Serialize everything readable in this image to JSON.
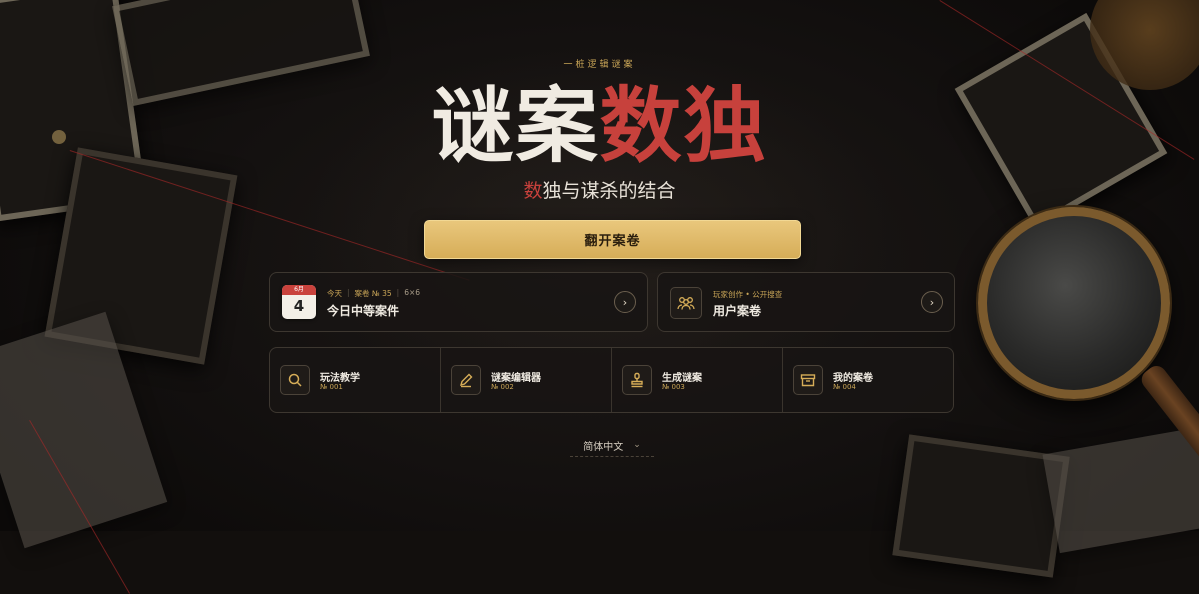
{
  "hero": {
    "tagline": "一桩逻辑谜案",
    "title_part1": "谜案",
    "title_part2": "数独",
    "subtitle_first": "数",
    "subtitle_rest": "独与谋杀的结合"
  },
  "cta": {
    "label": "翻开案卷"
  },
  "daily_case": {
    "calendar_month": "6月",
    "calendar_day": "4",
    "meta_today": "今天",
    "meta_case": "案卷 № 35",
    "meta_size": "6×6",
    "title": "今日中等案件",
    "arrow": "›"
  },
  "user_cases": {
    "meta": "玩家创作 • 公开搜查",
    "title": "用户案卷",
    "arrow": "›"
  },
  "tools": [
    {
      "label": "玩法教学",
      "number": "№ 001",
      "icon": "magnifier-icon"
    },
    {
      "label": "谜案编辑器",
      "number": "№ 002",
      "icon": "pencil-icon"
    },
    {
      "label": "生成谜案",
      "number": "№ 003",
      "icon": "stamp-icon"
    },
    {
      "label": "我的案卷",
      "number": "№ 004",
      "icon": "archive-box-icon"
    }
  ],
  "language": {
    "selected": "简体中文",
    "chevron": "⌄"
  },
  "colors": {
    "gold": "#d6ad58",
    "red": "#c7413c",
    "bg": "#120f0d"
  }
}
